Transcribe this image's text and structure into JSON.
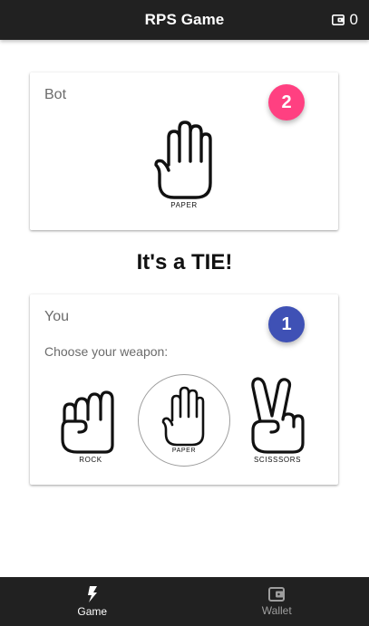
{
  "appbar": {
    "title": "RPS Game",
    "balance": "0",
    "balance_icon": "wallet-icon"
  },
  "bot": {
    "label": "Bot",
    "score": "2",
    "hand": "paper",
    "hand_caption": "PAPER",
    "badge_color": "#ff4081"
  },
  "result": {
    "text": "It's a TIE!"
  },
  "player": {
    "label": "You",
    "score": "1",
    "badge_color": "#3f51b5",
    "prompt": "Choose your weapon:",
    "selected": "paper",
    "weapons": [
      {
        "id": "rock",
        "caption": "ROCK",
        "icon": "rock-hand-icon"
      },
      {
        "id": "paper",
        "caption": "PAPER",
        "icon": "paper-hand-icon"
      },
      {
        "id": "scissors",
        "caption": "SCISSSORS",
        "icon": "scissors-hand-icon"
      }
    ]
  },
  "bottom_nav": {
    "active": "game",
    "items": [
      {
        "id": "game",
        "label": "Game",
        "icon": "lightning-icon"
      },
      {
        "id": "wallet",
        "label": "Wallet",
        "icon": "wallet-icon"
      }
    ]
  },
  "colors": {
    "bar_background": "#212121",
    "accent_pink": "#ff4081",
    "accent_indigo": "#3f51b5"
  }
}
